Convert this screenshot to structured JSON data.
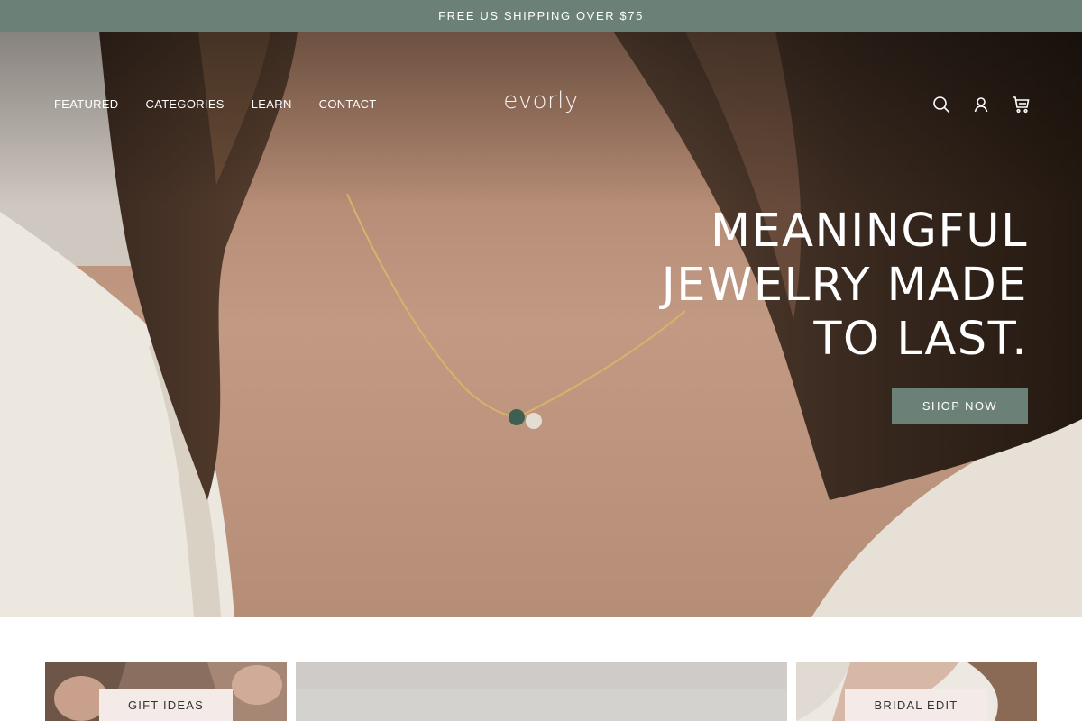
{
  "announcement": "FREE US SHIPPING OVER $75",
  "brand": {
    "logo_text": "evorly"
  },
  "nav": {
    "items": [
      {
        "label": "FEATURED"
      },
      {
        "label": "CATEGORIES"
      },
      {
        "label": "LEARN"
      },
      {
        "label": "CONTACT"
      }
    ]
  },
  "header_icons": [
    "search-icon",
    "account-icon",
    "cart-icon"
  ],
  "hero": {
    "headline": "MEANINGFUL\nJEWELRY MADE\nTO LAST.",
    "cta_label": "SHOP NOW"
  },
  "tiles": [
    {
      "label": "GIFT IDEAS"
    },
    {
      "label": ""
    },
    {
      "label": "BRIDAL EDIT"
    }
  ],
  "colors": {
    "accent": "#6b8076",
    "tile_label_bg": "#f4ebe8",
    "text_light": "#ffffff"
  }
}
